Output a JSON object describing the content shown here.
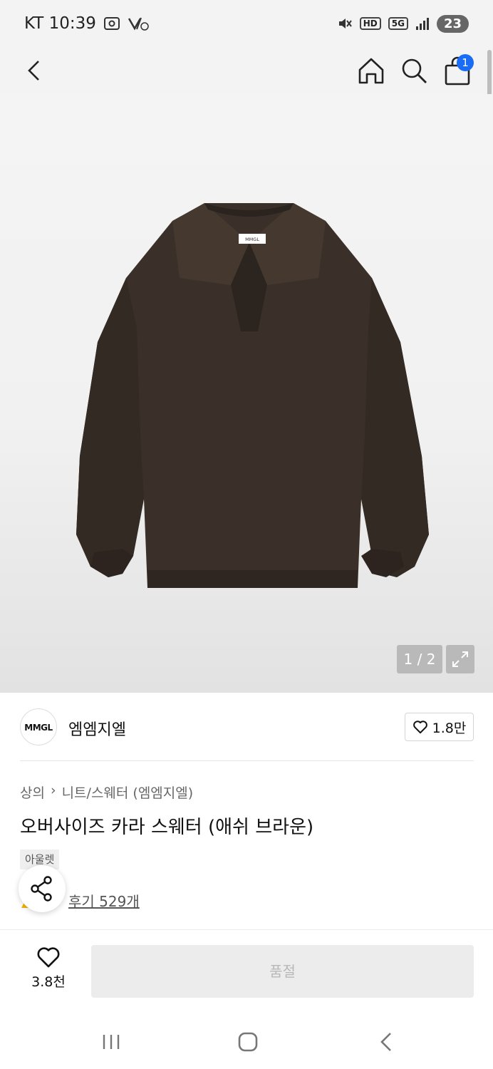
{
  "status_bar": {
    "carrier_time": "KT 10:39",
    "hd": "HD",
    "network": "5G",
    "battery": "23"
  },
  "nav": {
    "cart_count": "1"
  },
  "gallery": {
    "page_indicator": "1 / 2",
    "garment_label": "MMGL"
  },
  "brand": {
    "logo_text": "MMGL",
    "name": "엠엠지엘",
    "likes": "1.8만"
  },
  "product": {
    "breadcrumb": [
      "상의",
      "니트/스웨터 (엠엠지엘)"
    ],
    "title": "오버사이즈 카라 스웨터 (애쉬 브라운)",
    "tag": "아울렛",
    "reviews": "후기 529개"
  },
  "bottom": {
    "wish_count": "3.8천",
    "buy_label": "품절"
  },
  "colors": {
    "accent": "#1a6cf5",
    "sweater": "#3b3029"
  }
}
